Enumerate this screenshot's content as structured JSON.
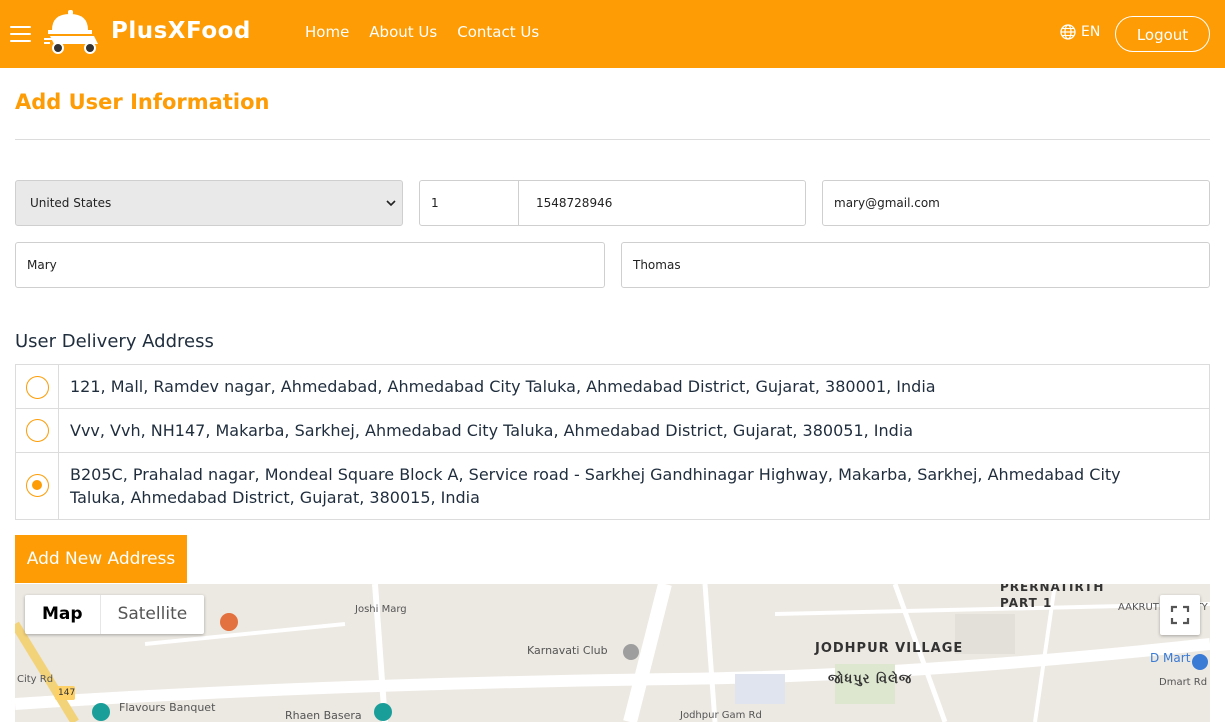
{
  "header": {
    "logo_text": "PlusXFood",
    "nav": [
      "Home",
      "About Us",
      "Contact Us"
    ],
    "language": "EN",
    "logout_label": "Logout",
    "accent_color": "#fd9c04"
  },
  "page": {
    "title": "Add User Information"
  },
  "form": {
    "country": "United States",
    "country_code": "1",
    "phone": "1548728946",
    "email": "mary@gmail.com",
    "first_name": "Mary",
    "last_name": "Thomas"
  },
  "delivery": {
    "title": "User Delivery Address",
    "addresses": [
      {
        "text": "121, Mall, Ramdev nagar, Ahmedabad, Ahmedabad City Taluka, Ahmedabad District, Gujarat, 380001, India",
        "selected": false
      },
      {
        "text": "Vvv, Vvh, NH147, Makarba, Sarkhej, Ahmedabad City Taluka, Ahmedabad District, Gujarat, 380051, India",
        "selected": false
      },
      {
        "text": "B205C, Prahalad nagar, Mondeal Square Block A, Service road - Sarkhej Gandhinagar Highway, Makarba, Sarkhej, Ahmedabad City Taluka, Ahmedabad District, Gujarat, 380015, India",
        "selected": true
      }
    ],
    "add_button": "Add New Address"
  },
  "map": {
    "type_map": "Map",
    "type_satellite": "Satellite",
    "labels": {
      "jodhpur_village_en": "JODHPUR VILLAGE",
      "jodhpur_village_gu": "જોધપુર વિલેજ",
      "karnavati_club": "Karnavati Club",
      "flavours_banquet": "Flavours Banquet",
      "rhaen_basera": "Rhaen Basera",
      "city_rd": "City Rd",
      "joshi_marg": "Joshi Marg",
      "jodhpur_gam_rd": "Jodhpur Gam Rd",
      "prernatirth": "PRERNATIRTH",
      "part_1": "PART 1",
      "aakruti_society": "AAKRUTI SOCIETY",
      "d_mart": "D Mart",
      "dmart_rd": "Dmart Rd",
      "road_147": "147"
    }
  }
}
